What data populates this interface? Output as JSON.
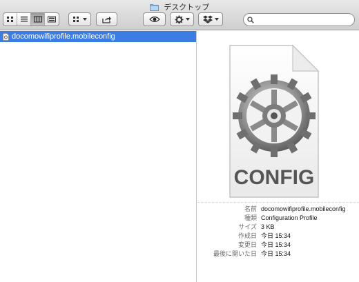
{
  "window": {
    "title": "デスクトップ"
  },
  "toolbar": {
    "view_modes": [
      "icon-view-icon",
      "list-view-icon",
      "column-view-icon",
      "coverflow-view-icon"
    ],
    "active_view": "column-view-icon",
    "arrange_icon": "arrange-icon",
    "share_icon": "share-icon",
    "quicklook_icon": "eye-icon",
    "action_icon": "gear-icon",
    "dropbox_icon": "dropbox-icon",
    "search": {
      "placeholder": "",
      "value": ""
    }
  },
  "list": {
    "items": [
      {
        "name": "docomowifiprofile.mobileconfig",
        "selected": true
      }
    ],
    "selected_color": "#3c7de3"
  },
  "preview": {
    "icon_label": "CONFIG",
    "info": [
      {
        "key": "名前",
        "value": "docomowifiprofile.mobileconfig"
      },
      {
        "key": "種類",
        "value": "Configuration Profile"
      },
      {
        "key": "サイズ",
        "value": "3 KB"
      },
      {
        "key": "作成日",
        "value": "今日 15:34"
      },
      {
        "key": "変更日",
        "value": "今日 15:34"
      },
      {
        "key": "最後に開いた日",
        "value": "今日 15:34"
      }
    ]
  }
}
